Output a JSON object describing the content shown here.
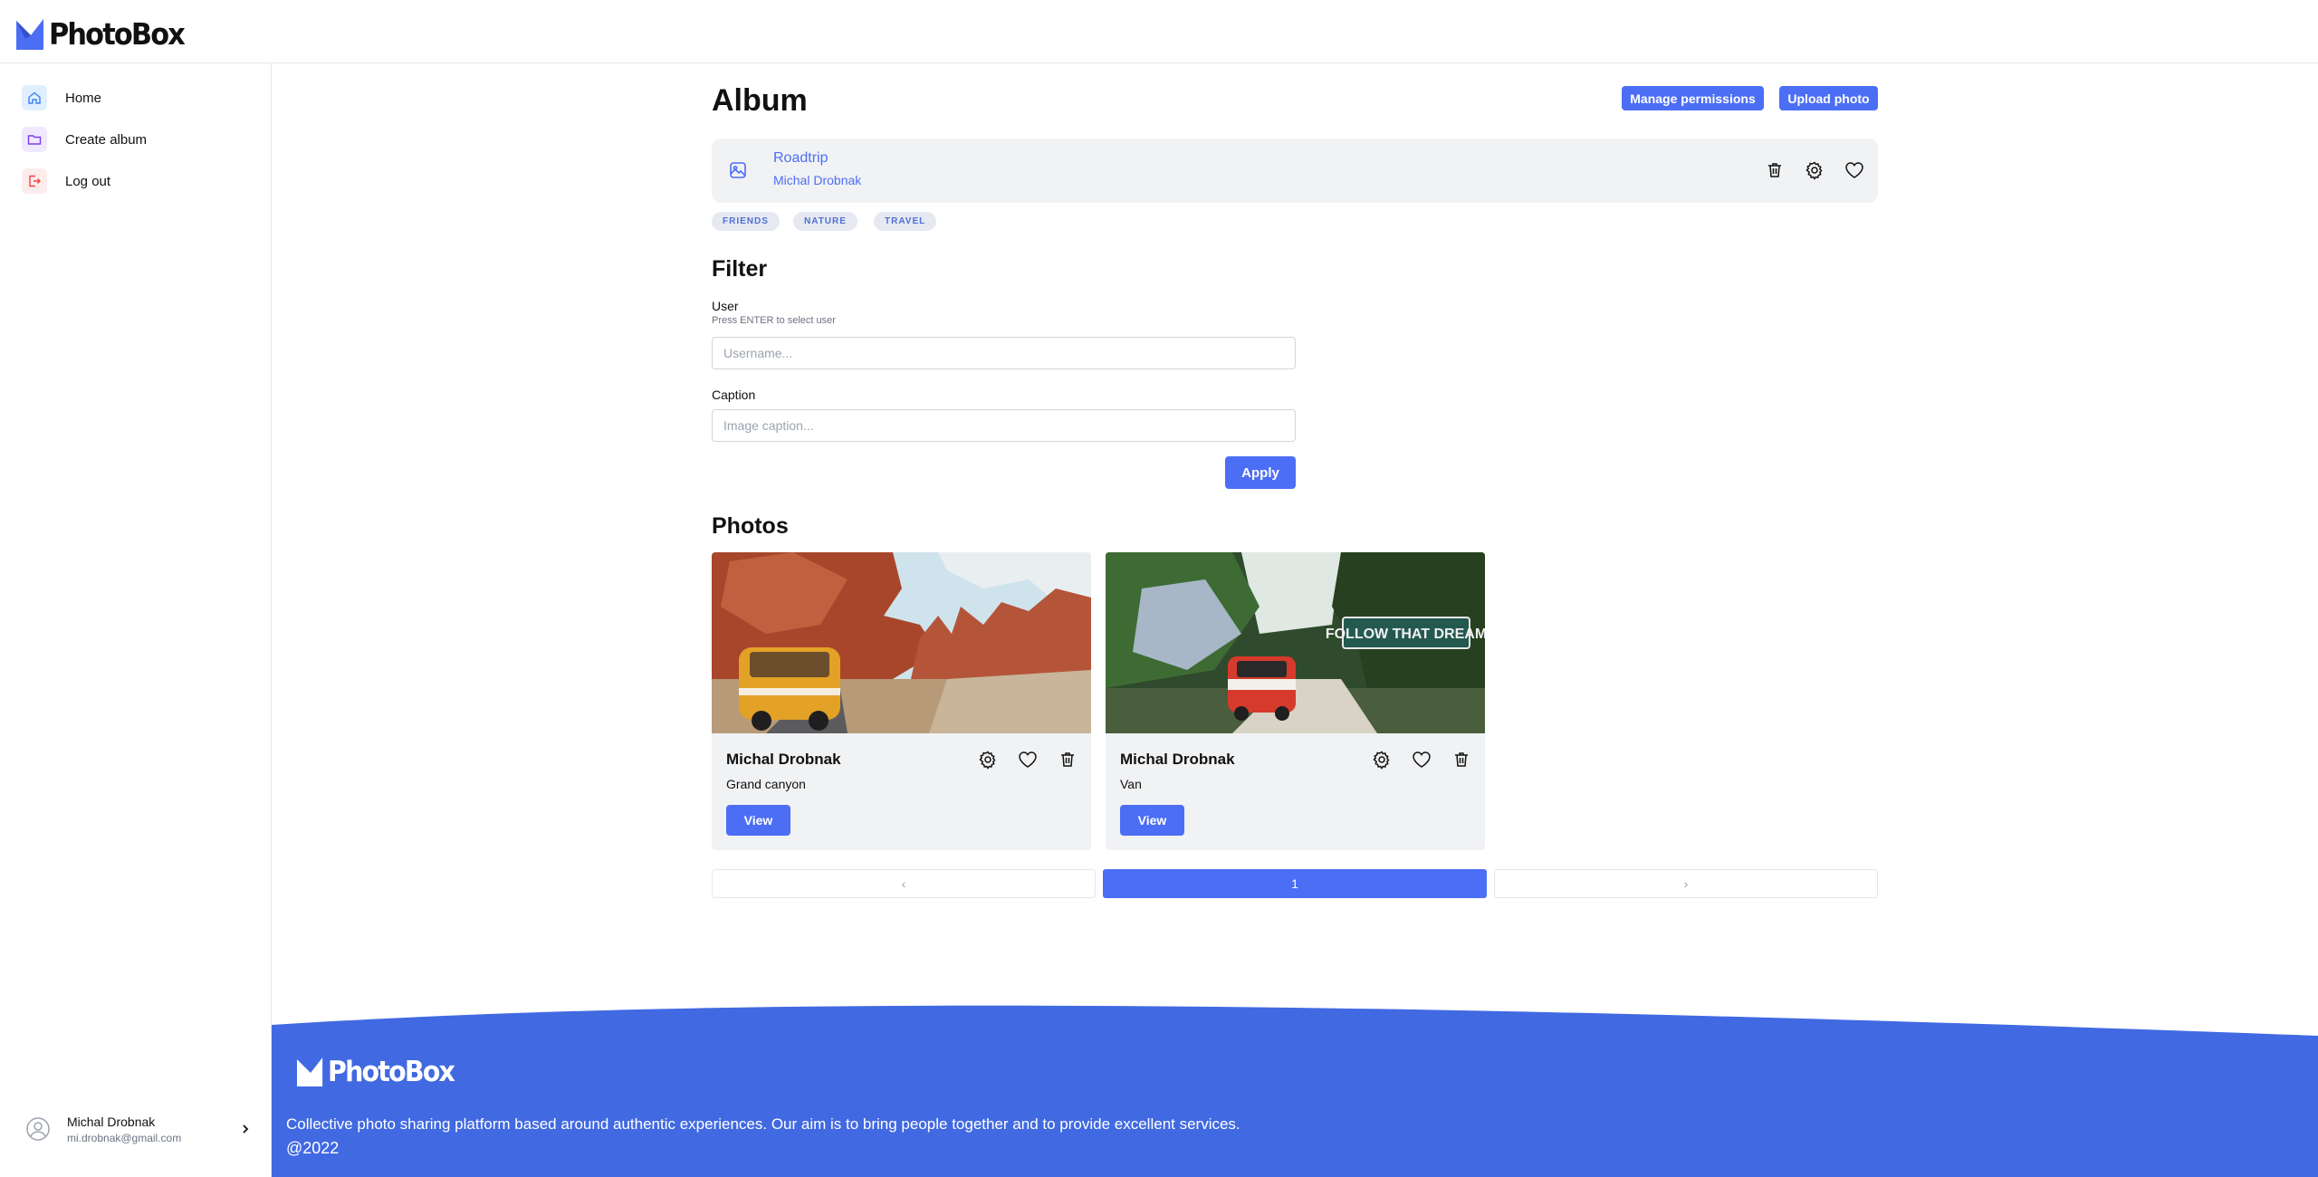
{
  "app": {
    "name": "PhotoBox"
  },
  "sidebar": {
    "items": [
      {
        "label": "Home",
        "icon": "home-icon",
        "color": "#3b82f6",
        "bg": "#e0effe"
      },
      {
        "label": "Create album",
        "icon": "folder-icon",
        "color": "#7c3aed",
        "bg": "#efe9fd"
      },
      {
        "label": "Log out",
        "icon": "logout-icon",
        "color": "#ef4444",
        "bg": "#fdecec"
      }
    ],
    "profile": {
      "name": "Michal Drobnak",
      "email": "mi.drobnak@gmail.com"
    }
  },
  "page": {
    "title": "Album",
    "manage_permissions_label": "Manage permissions",
    "upload_photo_label": "Upload photo"
  },
  "album": {
    "name": "Roadtrip",
    "owner": "Michal Drobnak",
    "tags": [
      "FRIENDS",
      "NATURE",
      "TRAVEL"
    ]
  },
  "filter": {
    "heading": "Filter",
    "user_label": "User",
    "user_hint": "Press ENTER to select user",
    "user_placeholder": "Username...",
    "user_value": "",
    "caption_label": "Caption",
    "caption_placeholder": "Image caption...",
    "caption_value": "",
    "apply_label": "Apply"
  },
  "photos": {
    "heading": "Photos",
    "items": [
      {
        "author": "Michal Drobnak",
        "caption": "Grand canyon",
        "view_label": "View"
      },
      {
        "author": "Michal Drobnak",
        "caption": "Van",
        "view_label": "View"
      }
    ]
  },
  "pagination": {
    "prev": "‹",
    "current": "1",
    "next": "›"
  },
  "footer": {
    "brand": "PhotoBox",
    "description": "Collective photo sharing platform based around authentic experiences. Our aim is to bring people together and to provide excellent services.",
    "copyright": "@2022"
  },
  "colors": {
    "accent": "#4c6ef5",
    "footer": "#4169e1"
  }
}
